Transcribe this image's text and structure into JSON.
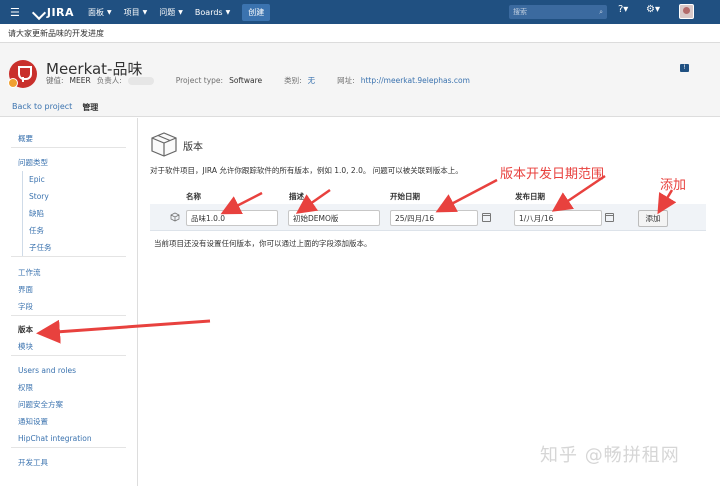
{
  "nav": {
    "logo": "JIRA",
    "items": [
      "面板",
      "项目",
      "问题",
      "Boards"
    ],
    "create": "创建",
    "search_placeholder": "搜索"
  },
  "announcement": "请大家更新品味的开发进度",
  "project": {
    "name": "Meerkat-品味",
    "key_label": "键值:",
    "key": "MEER",
    "lead_label": "负责人:",
    "type_label": "Project type:",
    "type": "Software",
    "category_label": "类别:",
    "category": "无",
    "url_label": "网址:",
    "url": "http://meerkat.9elephas.com"
  },
  "tabs": {
    "back": "Back to project",
    "admin": "管理"
  },
  "sidebar": {
    "items": [
      "概要",
      "问题类型",
      "Epic",
      "Story",
      "缺陷",
      "任务",
      "子任务",
      "工作流",
      "界面",
      "字段",
      "版本",
      "模块",
      "Users and roles",
      "权限",
      "问题安全方案",
      "通知设置",
      "HipChat integration",
      "开发工具"
    ]
  },
  "page": {
    "title": "版本",
    "description": "对于软件项目，JIRA 允许你跟踪软件的所有版本，例如 1.0, 2.0。 问题可以被关联到版本上。",
    "columns": {
      "name": "名称",
      "description": "描述",
      "start": "开始日期",
      "release": "发布日期"
    },
    "form": {
      "name": "品味1.0.0",
      "description": "初始DEMO版",
      "start": "25/四月/16",
      "release": "1/八月/16",
      "add": "添加"
    },
    "empty": "当前项目还没有设置任何版本，你可以通过上面的字段添加版本。"
  },
  "annotations": {
    "date_range": "版本开发日期范围",
    "add": "添加"
  },
  "watermark": "知乎 @畅拼租网",
  "colors": {
    "nav": "#205081",
    "link": "#3b73af",
    "annotation": "#e8413e"
  }
}
